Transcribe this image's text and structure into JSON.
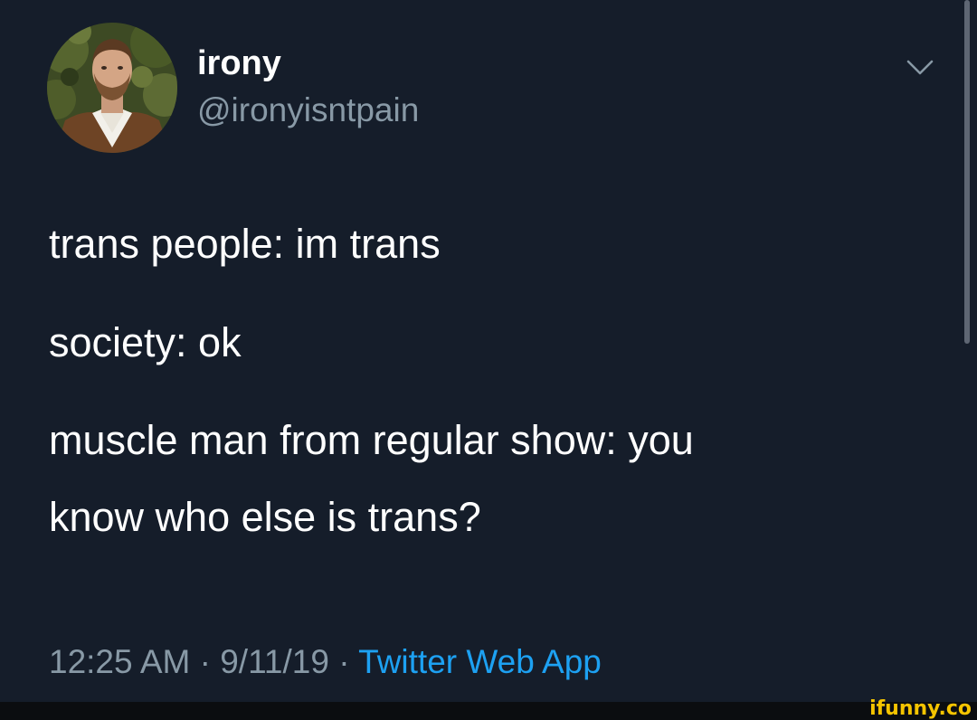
{
  "tweet": {
    "author": {
      "display_name": "irony",
      "handle": "@ironyisntpain",
      "avatar_icon": "profile-photo"
    },
    "lines": [
      "trans people: im trans",
      "society: ok",
      "muscle man from regular show: you",
      "know who else is trans?"
    ],
    "meta": {
      "time": "12:25 AM",
      "separator": " · ",
      "date": "9/11/19",
      "source": "Twitter Web App"
    },
    "menu_icon": "chevron-down-icon"
  },
  "watermark": {
    "text": "ifunny.co"
  },
  "colors": {
    "background": "#151d2a",
    "text": "#ffffff",
    "secondary_text": "#8899a6",
    "link": "#1da1f2",
    "watermark": "#f5c400"
  }
}
